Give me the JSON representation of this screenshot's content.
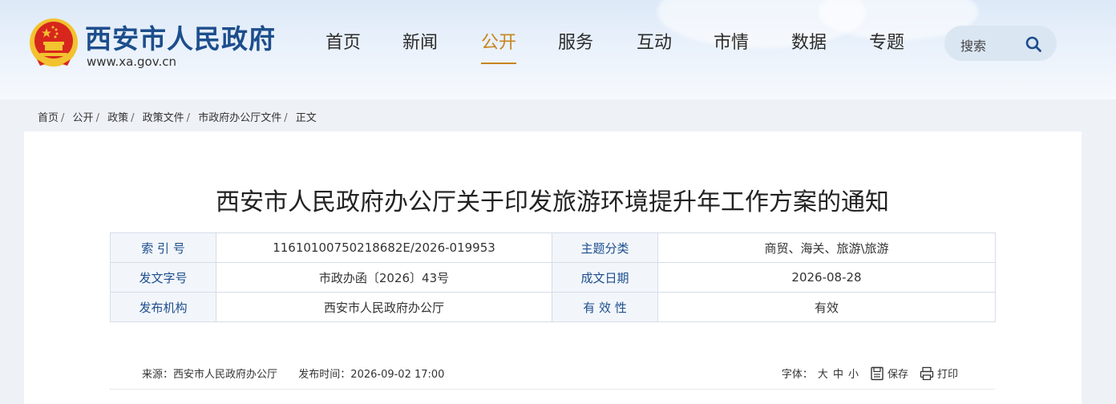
{
  "header": {
    "site_name": "西安市人民政府",
    "site_url": "www.xa.gov.cn",
    "nav": [
      {
        "label": "首页",
        "active": false
      },
      {
        "label": "新闻",
        "active": false
      },
      {
        "label": "公开",
        "active": true
      },
      {
        "label": "服务",
        "active": false
      },
      {
        "label": "互动",
        "active": false
      },
      {
        "label": "市情",
        "active": false
      },
      {
        "label": "数据",
        "active": false
      },
      {
        "label": "专题",
        "active": false
      }
    ],
    "search_label": "搜索"
  },
  "breadcrumb": [
    "首页",
    "公开",
    "政策",
    "政策文件",
    "市政府办公厅文件",
    "正文"
  ],
  "article": {
    "title": "西安市人民政府办公厅关于印发旅游环境提升年工作方案的通知",
    "meta": {
      "index_label": "索 引 号",
      "index_value": "11610100750218682E/2026-019953",
      "topic_label": "主题分类",
      "topic_value": "商贸、海关、旅游\\旅游",
      "doc_no_label": "发文字号",
      "doc_no_value": "市政办函〔2026〕43号",
      "date_label": "成文日期",
      "date_value": "2026-08-28",
      "issuer_label": "发布机构",
      "issuer_value": "西安市人民政府办公厅",
      "validity_label": "有 效 性",
      "validity_value": "有效"
    },
    "source": "来源：西安市人民政府办公厅",
    "publish_time": "发布时间：2026-09-02 17:00",
    "font_label": "字体：",
    "font_sizes": [
      "大",
      "中",
      "小"
    ],
    "save_label": "保存",
    "print_label": "打印"
  },
  "colors": {
    "brand_blue": "#1d4e8c",
    "nav_active": "#c8851f",
    "emblem_red": "#d7261e",
    "emblem_gold": "#f2c230"
  }
}
